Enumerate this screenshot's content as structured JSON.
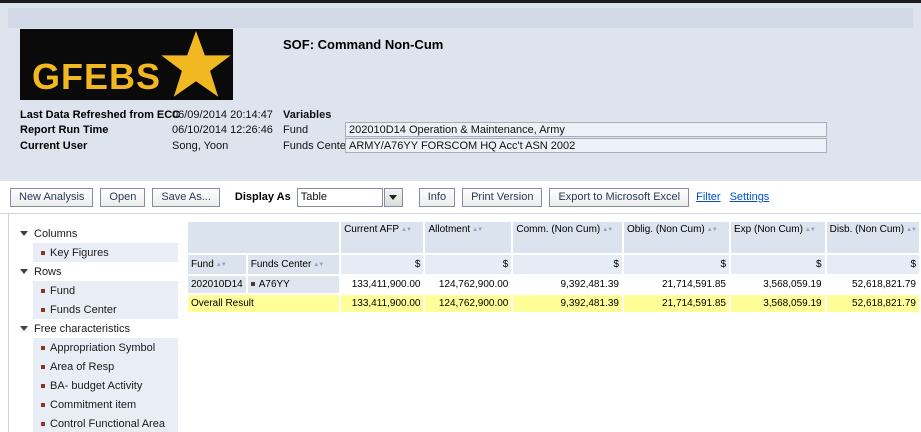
{
  "header": {
    "logo_text": "GFEBS",
    "title": "SOF: Command Non-Cum",
    "info_rows": [
      {
        "label": "Last Data Refreshed from ECC",
        "value": "06/09/2014 20:14:47"
      },
      {
        "label": "Report Run Time",
        "value": "06/10/2014 12:26:46"
      },
      {
        "label": "Current User",
        "value": "Song, Yoon"
      }
    ],
    "variables": {
      "section_label": "Variables",
      "fields": [
        {
          "label": "Fund",
          "value": "202010D14 Operation & Maintenance, Army"
        },
        {
          "label": "Funds Center",
          "value": "ARMY/A76YY FORSCOM HQ Acc't ASN 2002"
        }
      ]
    }
  },
  "toolbar": {
    "buttons_left": [
      "New Analysis",
      "Open",
      "Save As..."
    ],
    "display_as_label": "Display As",
    "display_as_value": "Table",
    "buttons_right": [
      "Info",
      "Print Version",
      "Export to Microsoft Excel"
    ],
    "links": [
      "Filter",
      "Settings"
    ]
  },
  "sidebar": {
    "groups": [
      {
        "label": "Columns",
        "items": [
          "Key Figures"
        ]
      },
      {
        "label": "Rows",
        "items": [
          "Fund",
          "Funds Center"
        ]
      },
      {
        "label": "Free characteristics",
        "items": [
          "Appropriation Symbol",
          "Area of Resp",
          "BA- budget Activity",
          "Commitment item",
          "Control Functional Area"
        ]
      }
    ]
  },
  "table": {
    "row_headers": [
      "Fund",
      "Funds Center"
    ],
    "columns": [
      "Current AFP",
      "Allotment",
      "Comm. (Non Cum)",
      "Oblig. (Non Cum)",
      "Exp (Non Cum)",
      "Disb. (Non Cum)"
    ],
    "unit": "$",
    "rows": [
      {
        "fund": "202010D14",
        "funds_center": "A76YY",
        "values": [
          "133,411,900.00",
          "124,762,900.00",
          "9,392,481.39",
          "21,714,591.85",
          "3,568,059.19",
          "52,618,821.79"
        ]
      }
    ],
    "result_row": {
      "label": "Overall Result",
      "values": [
        "133,411,900.00",
        "124,762,900.00",
        "9,392,481.39",
        "21,714,591.85",
        "3,568,059.19",
        "52,618,821.79"
      ]
    }
  },
  "colors": {
    "brand_gold": "#f2b822",
    "result_row_yellow": "#ffff99",
    "header_cell_blue": "#dbe3ef",
    "link_blue": "#0050cc",
    "page_header_background": "#dde4ee"
  }
}
